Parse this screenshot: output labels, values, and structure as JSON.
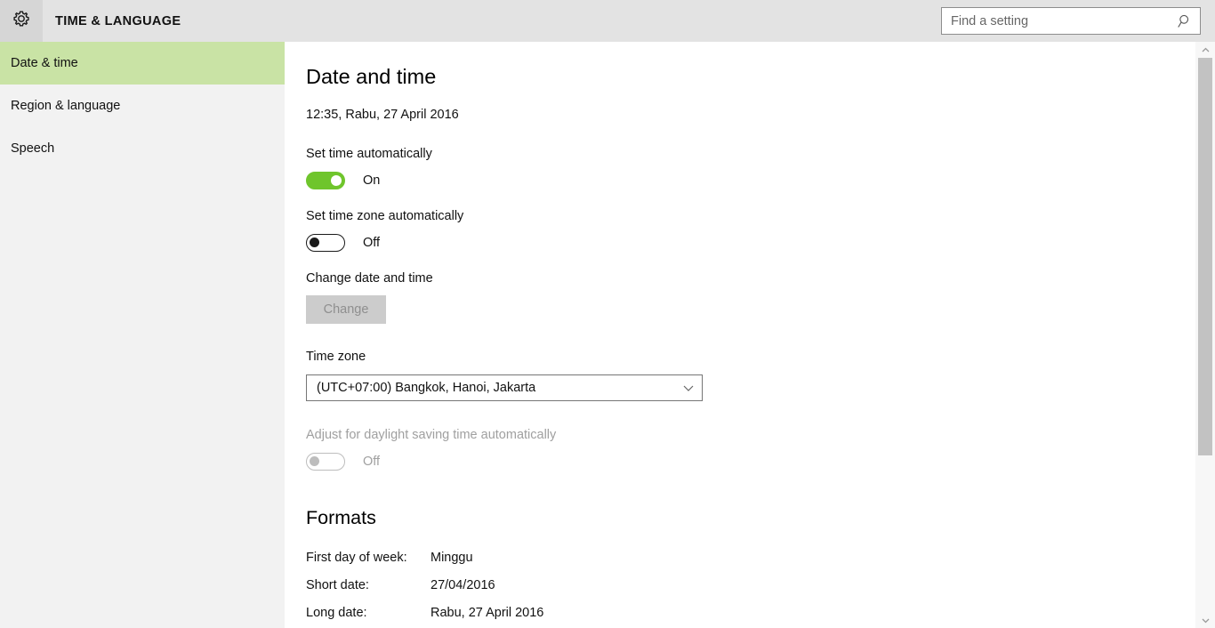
{
  "header": {
    "gear_icon": "gear-icon",
    "title": "TIME & LANGUAGE",
    "search": {
      "value": "",
      "placeholder": "Find a setting",
      "icon": "search-icon"
    }
  },
  "sidebar": {
    "items": [
      {
        "label": "Date & time",
        "selected": true
      },
      {
        "label": "Region & language",
        "selected": false
      },
      {
        "label": "Speech",
        "selected": false
      }
    ],
    "selected_color": "#c9e3a5",
    "background": "#f2f2f2"
  },
  "main": {
    "heading": "Date and time",
    "current_datetime": "12:35, Rabu, 27 April 2016",
    "set_time_automatically": {
      "label": "Set time automatically",
      "state_text": "On",
      "state": "on",
      "color": "#6fc52c"
    },
    "set_timezone_automatically": {
      "label": "Set time zone automatically",
      "state_text": "Off",
      "state": "off"
    },
    "change_date_time": {
      "label": "Change date and time",
      "button_label": "Change",
      "disabled": true
    },
    "time_zone": {
      "label": "Time zone",
      "value": "(UTC+07:00) Bangkok, Hanoi, Jakarta",
      "chevron_icon": "chevron-down-icon"
    },
    "daylight_saving": {
      "label": "Adjust for daylight saving time automatically",
      "state_text": "Off",
      "state": "off",
      "disabled": true
    },
    "formats": {
      "heading": "Formats",
      "rows": [
        {
          "label": "First day of week:",
          "value": "Minggu"
        },
        {
          "label": "Short date:",
          "value": "27/04/2016"
        },
        {
          "label": "Long date:",
          "value": "Rabu, 27 April 2016"
        }
      ]
    }
  },
  "scrollbar": {
    "up_arrow_icon": "chevron-up-icon",
    "down_arrow_icon": "chevron-down-icon"
  }
}
